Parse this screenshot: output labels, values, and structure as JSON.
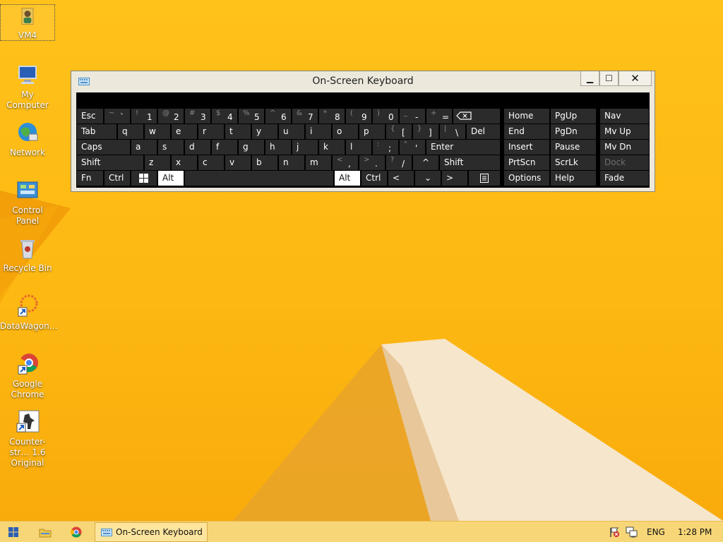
{
  "desktop": {
    "icons": [
      {
        "label": "VM4",
        "icon": "user-folder-icon"
      },
      {
        "label": "My Computer",
        "icon": "computer-icon"
      },
      {
        "label": "Network",
        "icon": "network-icon"
      },
      {
        "label": "Control Panel",
        "icon": "control-panel-icon"
      },
      {
        "label": "Recycle Bin",
        "icon": "recycle-bin-icon"
      },
      {
        "label": "DataWagon…",
        "icon": "datawagon-icon"
      },
      {
        "label": "Google Chrome",
        "icon": "chrome-icon"
      },
      {
        "label": "Counter-str… 1.6 Original",
        "icon": "counter-strike-icon"
      }
    ]
  },
  "osk": {
    "title": "On-Screen Keyboard",
    "buttons": {
      "minimize": "▁",
      "maximize": "☐",
      "close": "✕"
    },
    "keys": {
      "esc": "Esc",
      "tab": "Tab",
      "caps": "Caps",
      "shift_l": "Shift",
      "fn": "Fn",
      "ctrl_l": "Ctrl",
      "alt_l": "Alt",
      "alt_r": "Alt",
      "ctrl_r": "Ctrl",
      "del": "Del",
      "enter": "Enter",
      "shift_r": "Shift",
      "tilde": {
        "shift": "~",
        "main": "`"
      },
      "n1": {
        "shift": "!",
        "main": "1"
      },
      "n2": {
        "shift": "@",
        "main": "2"
      },
      "n3": {
        "shift": "#",
        "main": "3"
      },
      "n4": {
        "shift": "$",
        "main": "4"
      },
      "n5": {
        "shift": "%",
        "main": "5"
      },
      "n6": {
        "shift": "^",
        "main": "6"
      },
      "n7": {
        "shift": "&",
        "main": "7"
      },
      "n8": {
        "shift": "*",
        "main": "8"
      },
      "n9": {
        "shift": "(",
        "main": "9"
      },
      "n0": {
        "shift": ")",
        "main": "0"
      },
      "minus": {
        "shift": "_",
        "main": "-"
      },
      "equal": {
        "shift": "+",
        "main": "="
      },
      "q": "q",
      "w": "w",
      "e": "e",
      "r": "r",
      "t": "t",
      "y": "y",
      "u": "u",
      "i": "i",
      "o": "o",
      "p": "p",
      "lbracket": {
        "shift": "{",
        "main": "["
      },
      "rbracket": {
        "shift": "}",
        "main": "]"
      },
      "backslash": {
        "shift": "|",
        "main": "\\"
      },
      "a": "a",
      "s": "s",
      "d": "d",
      "f": "f",
      "g": "g",
      "h": "h",
      "j": "j",
      "k": "k",
      "l": "l",
      "semicolon": {
        "shift": ":",
        "main": ";"
      },
      "quote": {
        "shift": "\"",
        "main": "'"
      },
      "z": "z",
      "x": "x",
      "c": "c",
      "v": "v",
      "b": "b",
      "n": "n",
      "m": "m",
      "comma": {
        "shift": "<",
        "main": ","
      },
      "period": {
        "shift": ">",
        "main": "."
      },
      "slash": {
        "shift": "?",
        "main": "/"
      },
      "up": "^",
      "left": "<",
      "down": "⌄",
      "right": ">",
      "home": "Home",
      "pgup": "PgUp",
      "nav": "Nav",
      "end": "End",
      "pgdn": "PgDn",
      "mvup": "Mv Up",
      "insert": "Insert",
      "pause": "Pause",
      "mvdn": "Mv Dn",
      "prtscn": "PrtScn",
      "scrlk": "ScrLk",
      "dock": "Dock",
      "options": "Options",
      "help": "Help",
      "fade": "Fade"
    }
  },
  "taskbar": {
    "app_label": "On-Screen Keyboard",
    "language": "ENG",
    "time": "1:28 PM"
  },
  "colors": {
    "accent": "#fdb812",
    "key_bg": "#2b2b2b",
    "active_key": "#ffffff"
  }
}
